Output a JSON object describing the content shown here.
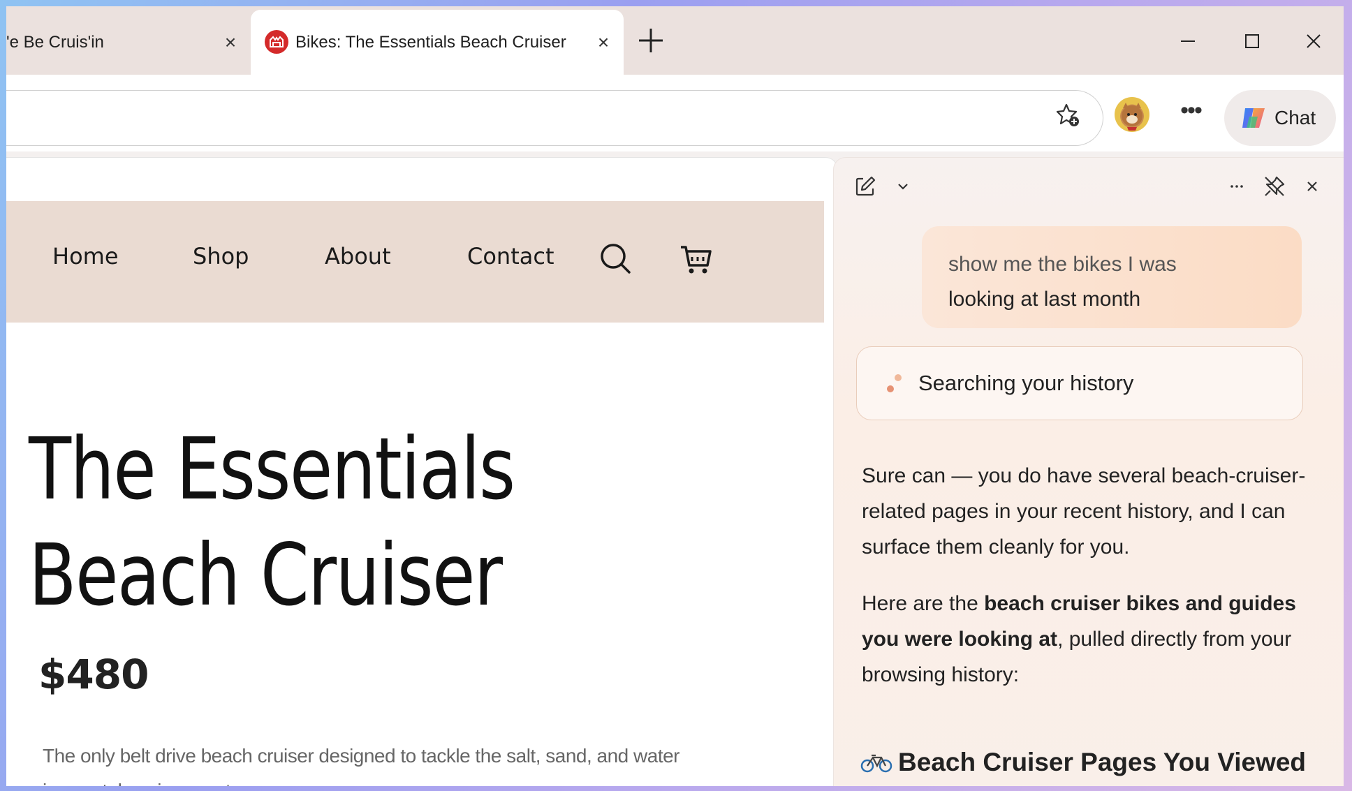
{
  "browser": {
    "tabs": [
      {
        "title": "We Be Cruis'in",
        "visible_title": "'e Be Cruis'in",
        "active": false
      },
      {
        "title": "Bikes: The Essentials Beach Cruiser",
        "active": true
      }
    ],
    "tab_close_glyph": "×",
    "chat_button_label": "Chat",
    "icons": [
      "favicon-bike-logo",
      "new-tab-icon",
      "minimize-icon",
      "maximize-icon",
      "close-window-icon",
      "favorite-add-icon",
      "profile-avatar",
      "more-options-icon",
      "copilot-icon"
    ]
  },
  "site": {
    "nav": [
      "Home",
      "Shop",
      "About",
      "Contact"
    ],
    "product": {
      "title_line1": "The Essentials",
      "title_line2": "Beach Cruiser",
      "price": "$480",
      "description": "The only belt drive beach cruiser designed to tackle the salt, sand, and water in coastal environments."
    }
  },
  "copilot": {
    "user_message_line1": "show me the bikes I was",
    "user_message_line2": "looking at last month",
    "status": "Searching your history",
    "answer_p1": "Sure can — you do have several beach-cruiser-related pages in your recent history, and I can surface them cleanly for you.",
    "answer_p2_prefix": "Here are the ",
    "answer_p2_bold": "beach cruiser bikes and guides you were looking at",
    "answer_p2_suffix": ", pulled directly from your browsing history:",
    "heading": "Beach Cruiser Pages You Viewed"
  },
  "colors": {
    "nav_bg": "#eadbd2",
    "favicon": "#d42a2a",
    "user_bubble": "#fbdcc5"
  }
}
